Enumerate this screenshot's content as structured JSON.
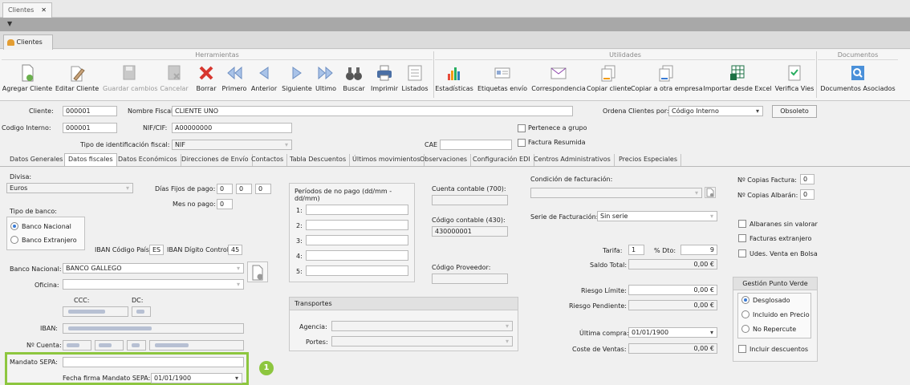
{
  "window_tab": {
    "label": "Clientes",
    "close": "✕",
    "menu": "▼"
  },
  "doc_tab": {
    "label": "Clientes"
  },
  "ribbon": {
    "groups": [
      "Herramientas",
      "Utilidades",
      "Documentos"
    ],
    "buttons": [
      "Agregar Cliente",
      "Editar Cliente",
      "Guardar cambios",
      "Cancelar",
      "Borrar",
      "Primero",
      "Anterior",
      "Siguiente",
      "Ultimo",
      "Buscar",
      "Imprimir",
      "Listados",
      "Estadísticas",
      "Etiquetas envío",
      "Correspondencia",
      "Copiar cliente",
      "Copiar a otra empresa",
      "Importar desde Excel",
      "Verifica Vies",
      "Documentos Asociados"
    ]
  },
  "header": {
    "cliente_label": "Cliente:",
    "cliente_value": "000001",
    "nombre_label": "Nombre Fiscal:",
    "nombre_value": "CLIENTE UNO",
    "ordena_label": "Ordena Clientes por:",
    "ordena_value": "Código Interno",
    "obsoleto": "Obsoleto",
    "codigo_label": "Codigo Interno:",
    "codigo_value": "000001",
    "nif_label": "NIF/CIF:",
    "nif_value": "A00000000",
    "pertenece": "Pertenece a grupo",
    "tipo_label": "Tipo de identificación fiscal:",
    "tipo_value": "NIF",
    "cae_label": "CAE",
    "factura_resumida": "Factura Resumida"
  },
  "tabs": [
    "Datos Generales",
    "Datos fiscales",
    "Datos Económicos",
    "Direcciones de Envío",
    "Contactos",
    "Tabla Descuentos",
    "Últimos movimientos",
    "Observaciones",
    "Configuración EDI",
    "Centros Administrativos",
    "Precios Especiales"
  ],
  "left": {
    "divisa_label": "Divisa:",
    "divisa_value": "Euros",
    "dias_label": "Días Fijos de pago:",
    "dias": [
      "0",
      "0",
      "0"
    ],
    "mes_label": "Mes no pago:",
    "mes_value": "0",
    "tipo_banco_label": "Tipo de banco:",
    "banco_nacional": "Banco Nacional",
    "banco_extranjero": "Banco Extranjero",
    "iban_pais_label": "IBAN Código País:",
    "iban_pais": "ES",
    "iban_dc_label": "IBAN Dígito Control:",
    "iban_dc": "45",
    "banco_label": "Banco Nacional:",
    "banco_value": "BANCO GALLEGO",
    "oficina_label": "Oficina:",
    "ccc_label": "CCC:",
    "dc_label": "DC:",
    "iban_label": "IBAN:",
    "cuenta_label": "Nº Cuenta:",
    "mandato_label": "Mandato SEPA:",
    "fecha_label": "Fecha firma Mandato SEPA:",
    "fecha_value": "01/01/1900",
    "callout": "1"
  },
  "periodos": {
    "title": "Períodos de no pago (dd/mm - dd/mm)",
    "rows": [
      "1:",
      "2:",
      "3:",
      "4:",
      "5:"
    ]
  },
  "transportes": {
    "title": "Transportes",
    "agencia": "Agencia:",
    "portes": "Portes:"
  },
  "cuentas": {
    "contable_label": "Cuenta contable (700):",
    "codigo430_label": "Código contable (430):",
    "codigo430_value": "430000001",
    "proveedor_label": "Código Proveedor:"
  },
  "facturacion": {
    "condicion_label": "Condición de facturación:",
    "serie_label": "Serie de Facturación:",
    "serie_value": "Sin serie",
    "tarifa_label": "Tarifa:",
    "tarifa_value": "1",
    "dto_label": "% Dto:",
    "dto_value": "9",
    "saldo_label": "Saldo Total:",
    "saldo_value": "0,00 €",
    "riesgo_label": "Riesgo Límite:",
    "riesgo_value": "0,00 €",
    "pendiente_label": "Riesgo Pendiente:",
    "pendiente_value": "0,00 €",
    "ultima_label": "Última compra:",
    "ultima_value": "01/01/1900",
    "coste_label": "Coste de Ventas:",
    "coste_value": "0,00 €"
  },
  "right": {
    "copias_factura_label": "Nº Copias Factura:",
    "copias_factura": "0",
    "copias_albaran_label": "Nº Copias Albarán:",
    "copias_albaran": "0",
    "albaranes": "Albaranes sin valorar",
    "facturas_ext": "Facturas extranjero",
    "udes": "Udes. Venta en Bolsa",
    "verde_title": "Gestión Punto Verde",
    "desglosado": "Desglosado",
    "incluido": "Incluido en Precio",
    "no_repercute": "No Repercute",
    "incluir": "Incluir descuentos"
  },
  "colors": {
    "accent": "#3a7bd5",
    "highlight_box": "#8dc63f",
    "callout": "#8dc63f"
  }
}
